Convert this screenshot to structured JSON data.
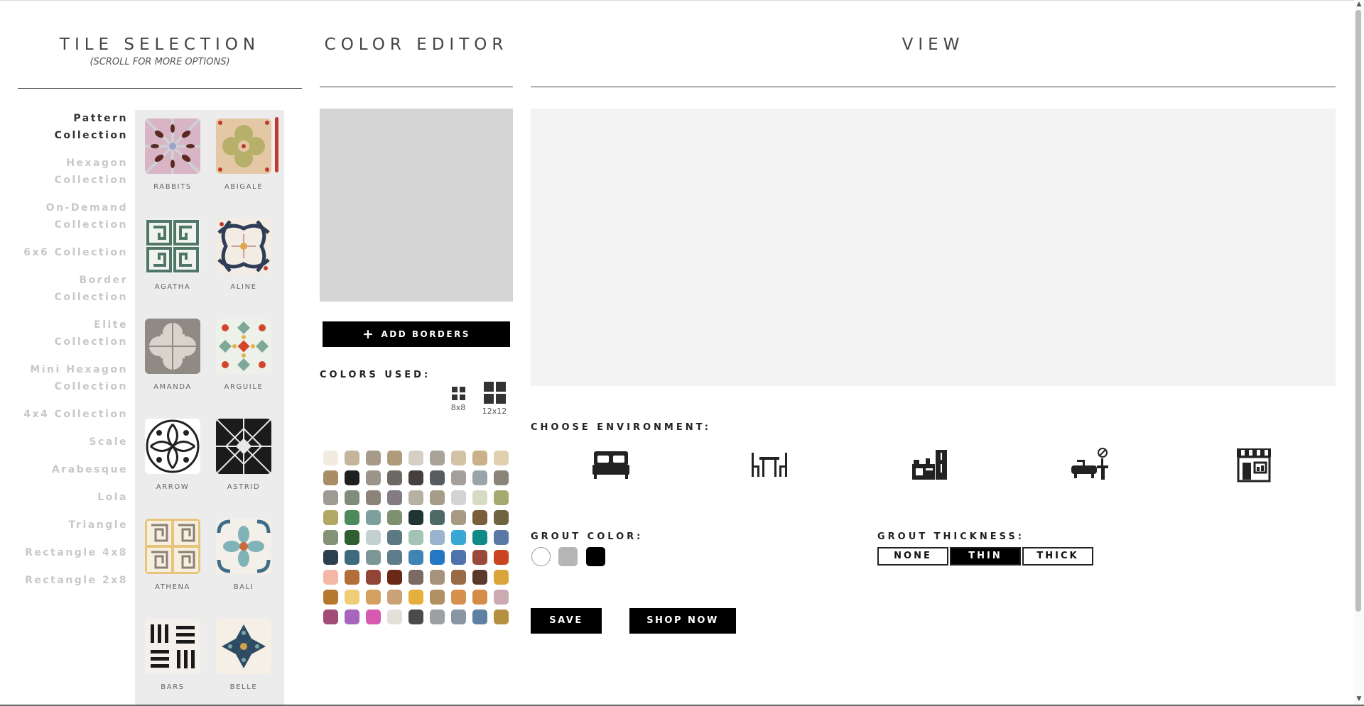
{
  "tile_selection": {
    "title": "TILE SELECTION",
    "subtitle": "(SCROLL FOR MORE OPTIONS)"
  },
  "color_editor": {
    "title": "COLOR EDITOR"
  },
  "view": {
    "title": "VIEW"
  },
  "collections": [
    "Pattern Collection",
    "Hexagon Collection",
    "On-Demand Collection",
    "6x6 Collection",
    "Border Collection",
    "Elite Collection",
    "Mini Hexagon Collection",
    "4x4 Collection",
    "Scale",
    "Arabesque",
    "Lola",
    "Triangle",
    "Rectangle 4x8",
    "Rectangle 2x8"
  ],
  "active_collection": "Pattern Collection",
  "tiles": [
    "RABBITS",
    "ABIGALE",
    "AGATHA",
    "ALINE",
    "AMANDA",
    "ARGUILE",
    "ARROW",
    "ASTRID",
    "ATHENA",
    "BALI",
    "BARS",
    "BELLE"
  ],
  "add_borders_label": "ADD BORDERS",
  "colors_used_label": "COLORS USED:",
  "size_options": [
    "8x8",
    "12x12"
  ],
  "palette": [
    "#f1ebe2",
    "#c4b49c",
    "#a89a88",
    "#ad9b7b",
    "#d6cfc4",
    "#aaa39a",
    "#d2c3a6",
    "#c9b18a",
    "#e0d0b0",
    "#a88d66",
    "#1f1f1f",
    "#9c9389",
    "#6d6a66",
    "#45403e",
    "#565c5f",
    "#a59f9b",
    "#9ba4a9",
    "#8b8478",
    "#9e9a94",
    "#7f8c7e",
    "#8c8478",
    "#857b82",
    "#b6b1a3",
    "#a69d89",
    "#d5d3d1",
    "#d5dcc1",
    "#a7aa70",
    "#b2a865",
    "#4d8a5a",
    "#7da09f",
    "#7d9170",
    "#1e3531",
    "#4d6a66",
    "#a79b84",
    "#7a5e3a",
    "#6f6440",
    "#849377",
    "#2f5e32",
    "#c4d0cf",
    "#5b7a83",
    "#a3c4b4",
    "#9ab4cf",
    "#3aa8d4",
    "#0f8a84",
    "#5a78a6",
    "#2c3e50",
    "#3e6b7c",
    "#7b9896",
    "#5c7c89",
    "#3f84b2",
    "#2477c2",
    "#4f73ac",
    "#9a4a3c",
    "#cb4421",
    "#f4b7a5",
    "#b36d3b",
    "#924437",
    "#6a2816",
    "#7a6a62",
    "#a6937b",
    "#9a6a44",
    "#5a3a2d",
    "#d9a53a",
    "#b5782e",
    "#f0ce78",
    "#d4a05f",
    "#c9a375",
    "#e4b03a",
    "#b09163",
    "#d6924c",
    "#d58c46",
    "#ccaab4",
    "#a24d78",
    "#a865be",
    "#d65aaf",
    "#e3e0d9",
    "#4a4a4a",
    "#9ca0a3",
    "#8b96a4",
    "#5f81a5",
    "#b59040"
  ],
  "choose_environment_label": "CHOOSE ENVIRONMENT:",
  "environments": [
    "bedroom",
    "dining",
    "kitchen",
    "bathroom",
    "storefront"
  ],
  "grout_color_label": "GROUT COLOR:",
  "grout_colors": [
    "#ffffff",
    "#b5b5b5",
    "#000000"
  ],
  "grout_thickness_label": "GROUT THICKNESS:",
  "grout_thickness": [
    "NONE",
    "THIN",
    "THICK"
  ],
  "grout_thickness_selected": "THIN",
  "save_label": "SAVE",
  "shop_label": "SHOP NOW"
}
